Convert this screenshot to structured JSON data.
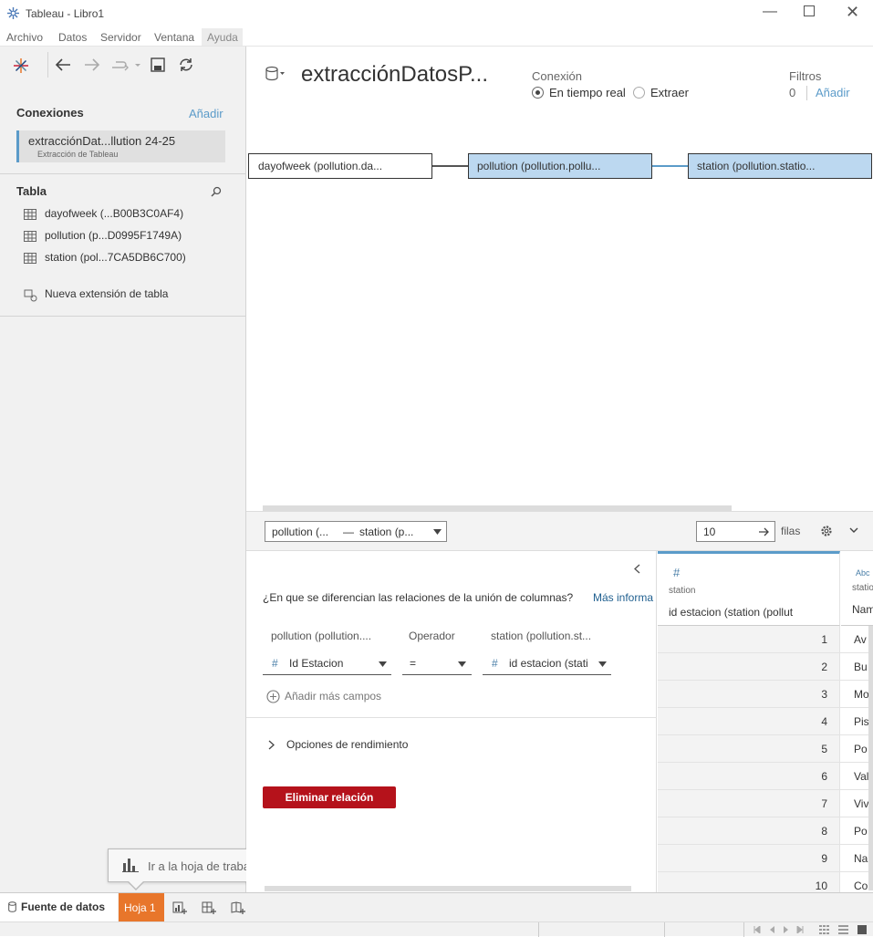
{
  "window": {
    "title": "Tableau - Libro1"
  },
  "menu": [
    "Archivo",
    "Datos",
    "Servidor",
    "Ventana",
    "Ayuda"
  ],
  "left": {
    "connections_title": "Conexiones",
    "add_label": "Añadir",
    "connection": {
      "name": "extracciónDat...llution 24-25",
      "subtitle": "Extracción de Tableau"
    },
    "table_title": "Tabla",
    "tables": [
      "dayofweek (...B00B3C0AF4)",
      "pollution (p...D0995F1749A)",
      "station (pol...7CA5DB6C700)"
    ],
    "new_extension": "Nueva extensión de tabla"
  },
  "header": {
    "datasource_name": "extracciónDatosP...",
    "connection_label": "Conexión",
    "live_label": "En tiempo real",
    "extract_label": "Extraer",
    "filters_label": "Filtros",
    "filters_count": "0",
    "filters_add": "Añadir"
  },
  "canvas": {
    "nodes": [
      "dayofweek (pollution.da...",
      "pollution (pollution.pollu...",
      "station (pollution.statio..."
    ]
  },
  "toolbar2": {
    "relation_left": "pollution (...",
    "relation_dash": "—",
    "relation_right": "station (p...",
    "rows_value": "10",
    "rows_label": "filas"
  },
  "relation_panel": {
    "question": "¿En que se diferencian las relaciones de la unión de columnas?",
    "more_info": "Más informa",
    "col_left_header": "pollution (pollution....",
    "col_op_header": "Operador",
    "col_right_header": "station (pollution.st...",
    "left_field": "Id Estacion",
    "operator": "=",
    "right_field": "id estacion (stati",
    "add_more": "Añadir más campos",
    "performance": "Opciones de rendimiento",
    "delete": "Eliminar relación"
  },
  "grid": {
    "col1": {
      "type_icon": "#",
      "source": "station",
      "name": "id estacion (station (pollut"
    },
    "col2": {
      "type_icon": "Abc",
      "source": "statio",
      "name": "Nam"
    },
    "rows": [
      {
        "id": "1",
        "name": "Av"
      },
      {
        "id": "2",
        "name": "Bu"
      },
      {
        "id": "3",
        "name": "Mo"
      },
      {
        "id": "4",
        "name": "Pis"
      },
      {
        "id": "5",
        "name": "Po"
      },
      {
        "id": "6",
        "name": "Val"
      },
      {
        "id": "7",
        "name": "Viv"
      },
      {
        "id": "8",
        "name": "Po"
      },
      {
        "id": "9",
        "name": "Na"
      },
      {
        "id": "10",
        "name": "Co"
      }
    ]
  },
  "tooltip": {
    "text": "Ir a la hoja de trabajo"
  },
  "tabs": {
    "datasource": "Fuente de datos",
    "sheet1": "Hoja 1"
  },
  "colors": {
    "accent": "#e8762b",
    "node_fill": "#bcd8f0",
    "delete": "#b5121b",
    "link": "#5b9bc9"
  }
}
